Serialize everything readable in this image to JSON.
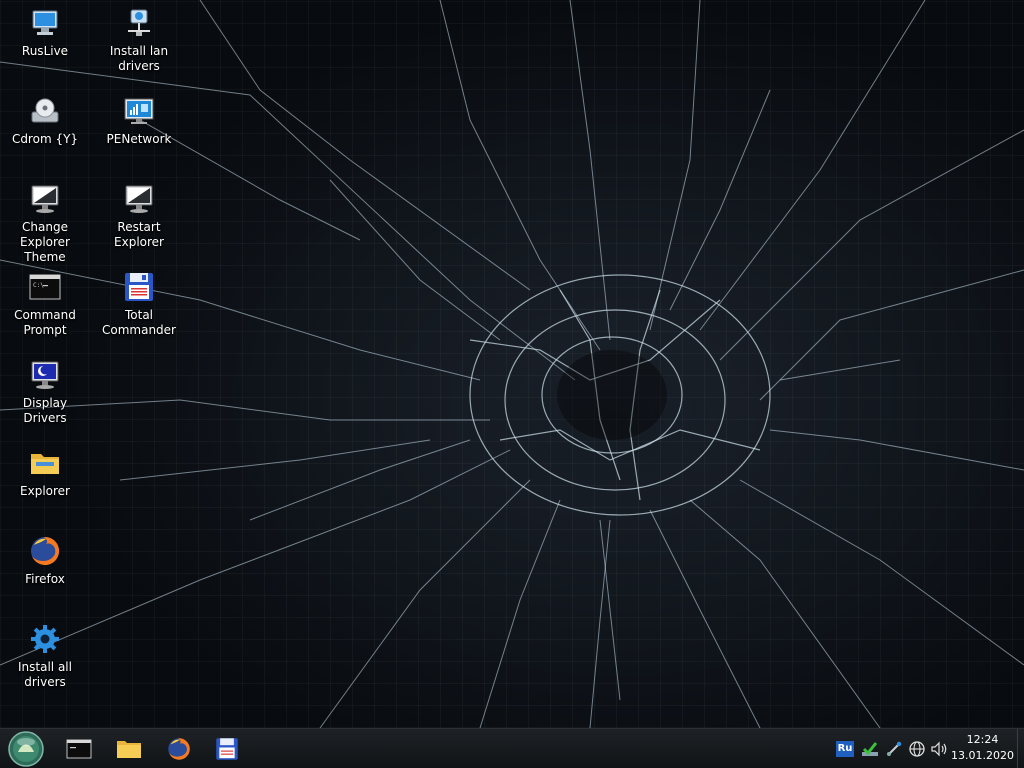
{
  "desktop": {
    "icons": [
      {
        "name": "ruslive-icon",
        "label": "RusLive"
      },
      {
        "name": "install-lan-drivers-icon",
        "label": "Install lan drivers"
      },
      {
        "name": "cdrom-icon",
        "label": "Cdrom {Y}"
      },
      {
        "name": "penetwork-icon",
        "label": "PENetwork"
      },
      {
        "name": "change-explorer-theme-icon",
        "label": "Change Explorer\nTheme"
      },
      {
        "name": "restart-explorer-icon",
        "label": "Restart Explorer"
      },
      {
        "name": "command-prompt-icon",
        "label": "Command\nPrompt"
      },
      {
        "name": "total-commander-icon",
        "label": "Total\nCommander"
      },
      {
        "name": "display-drivers-icon",
        "label": "Display Drivers"
      },
      {
        "name": "explorer-icon",
        "label": "Explorer"
      },
      {
        "name": "firefox-icon",
        "label": "Firefox"
      },
      {
        "name": "install-all-drivers-icon",
        "label": "Install all drivers"
      }
    ]
  },
  "taskbar": {
    "pinned": [
      {
        "name": "command-prompt-icon"
      },
      {
        "name": "explorer-folder-icon"
      },
      {
        "name": "firefox-icon"
      },
      {
        "name": "total-commander-icon"
      }
    ],
    "tray": {
      "language": "Ru",
      "icons": [
        "checkmark-icon",
        "network-tool-icon",
        "globe-icon",
        "speaker-icon"
      ]
    },
    "clock": {
      "time": "12:24",
      "date": "13.01.2020"
    }
  },
  "colors": {
    "taskbar": "#15181b",
    "desktop_background": "#11161d",
    "language_badge": "#1f5fbf"
  }
}
